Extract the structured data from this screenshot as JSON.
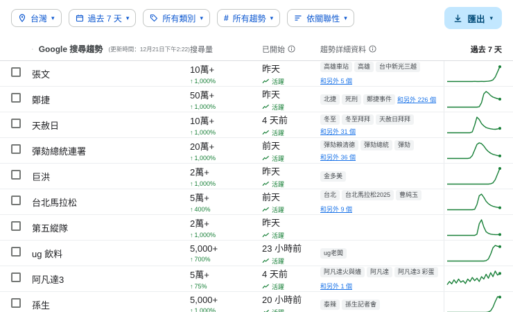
{
  "toolbar": {
    "chips": [
      {
        "icon": "location-pin",
        "label": "台灣"
      },
      {
        "icon": "calendar",
        "label": "過去 7 天"
      },
      {
        "icon": "category-tag",
        "label": "所有類別"
      },
      {
        "icon": "hash",
        "label": "所有趨勢"
      },
      {
        "icon": "sort",
        "label": "依關聯性"
      }
    ],
    "export": {
      "label": "匯出"
    }
  },
  "table": {
    "title": "Google 搜尋趨勢",
    "updated": "(更新時間：12月21日下午2:22)",
    "columns": {
      "volume": "搜尋量",
      "started": "已開始",
      "details": "趨勢詳細資料",
      "past": "過去 7 天"
    },
    "active_label": "活躍",
    "rows": [
      {
        "name": "張文",
        "volume": "10萬+",
        "change": "1,000%",
        "started": "昨天",
        "related": [
          "高雄車站",
          "高雄",
          "台中新光三越"
        ],
        "more": "和另外 5 個",
        "wrap": true,
        "spark": [
          0.02,
          0.02,
          0.02,
          0.02,
          0.02,
          0.02,
          0.02,
          0.02,
          0.02,
          0.02,
          0.02,
          0.02,
          0.03,
          0.02,
          0.02,
          0.03,
          0.02,
          0.03,
          0.04,
          0.06,
          0.12,
          0.3,
          0.62,
          0.95
        ]
      },
      {
        "name": "鄭捷",
        "volume": "50萬+",
        "change": "1,000%",
        "started": "昨天",
        "related": [
          "北捷",
          "死刑",
          "鄭捷事件"
        ],
        "more": "和另外 226 個",
        "wrap": false,
        "spark": [
          0.02,
          0.02,
          0.02,
          0.02,
          0.02,
          0.02,
          0.02,
          0.02,
          0.02,
          0.02,
          0.02,
          0.02,
          0.02,
          0.02,
          0.05,
          0.3,
          0.85,
          1.0,
          0.9,
          0.75,
          0.65,
          0.6,
          0.55,
          0.52
        ]
      },
      {
        "name": "天赦日",
        "volume": "10萬+",
        "change": "1,000%",
        "started": "4 天前",
        "related": [
          "冬至",
          "冬至拜拜",
          "天赦日拜拜"
        ],
        "more": "和另外 31 個",
        "wrap": false,
        "spark": [
          0.02,
          0.02,
          0.02,
          0.02,
          0.02,
          0.02,
          0.02,
          0.02,
          0.02,
          0.02,
          0.02,
          0.08,
          0.5,
          1.0,
          0.85,
          0.6,
          0.45,
          0.35,
          0.3,
          0.27,
          0.25,
          0.24,
          0.26,
          0.3
        ]
      },
      {
        "name": "彈劾總統連署",
        "volume": "20萬+",
        "change": "1,000%",
        "started": "前天",
        "related": [
          "彈劾賴清德",
          "彈劾總統",
          "彈劾"
        ],
        "more": "和另外 36 個",
        "wrap": false,
        "spark": [
          0.02,
          0.02,
          0.02,
          0.02,
          0.02,
          0.02,
          0.02,
          0.02,
          0.02,
          0.02,
          0.05,
          0.2,
          0.55,
          0.9,
          1.0,
          0.95,
          0.8,
          0.6,
          0.45,
          0.35,
          0.28,
          0.24,
          0.2,
          0.18
        ]
      },
      {
        "name": "巨洪",
        "volume": "2萬+",
        "change": "1,000%",
        "started": "昨天",
        "related": [
          "金多美"
        ],
        "more": null,
        "wrap": false,
        "spark": [
          0.02,
          0.02,
          0.02,
          0.02,
          0.02,
          0.02,
          0.02,
          0.02,
          0.02,
          0.02,
          0.02,
          0.02,
          0.02,
          0.02,
          0.02,
          0.02,
          0.02,
          0.02,
          0.02,
          0.04,
          0.1,
          0.3,
          0.65,
          1.0
        ]
      },
      {
        "name": "台北馬拉松",
        "volume": "5萬+",
        "change": "400%",
        "started": "前天",
        "related": [
          "台北",
          "台北馬拉松2025",
          "曹純玉"
        ],
        "more": "和另外 9 個",
        "wrap": true,
        "spark": [
          0.02,
          0.02,
          0.02,
          0.02,
          0.02,
          0.02,
          0.02,
          0.02,
          0.02,
          0.02,
          0.02,
          0.02,
          0.05,
          0.35,
          0.9,
          1.0,
          0.8,
          0.55,
          0.4,
          0.3,
          0.24,
          0.2,
          0.17,
          0.15
        ]
      },
      {
        "name": "第五縱隊",
        "volume": "2萬+",
        "change": "1,000%",
        "started": "昨天",
        "related": [],
        "more": null,
        "wrap": false,
        "spark": [
          0.02,
          0.02,
          0.02,
          0.02,
          0.02,
          0.02,
          0.02,
          0.02,
          0.02,
          0.02,
          0.02,
          0.02,
          0.02,
          0.1,
          0.75,
          1.0,
          0.55,
          0.25,
          0.15,
          0.1,
          0.08,
          0.07,
          0.07,
          0.08
        ]
      },
      {
        "name": "ug 飲料",
        "volume": "5,000+",
        "change": "700%",
        "started": "23 小時前",
        "related": [
          "ug老闆"
        ],
        "more": null,
        "wrap": false,
        "spark": [
          0.02,
          0.02,
          0.02,
          0.02,
          0.02,
          0.02,
          0.02,
          0.02,
          0.02,
          0.02,
          0.02,
          0.02,
          0.02,
          0.02,
          0.02,
          0.02,
          0.02,
          0.05,
          0.15,
          0.45,
          0.85,
          1.0,
          0.95,
          0.92
        ]
      },
      {
        "name": "阿凡達3",
        "volume": "5萬+",
        "change": "75%",
        "started": "4 天前",
        "related": [
          "阿凡達火與燼",
          "阿凡達",
          "阿凡達3 彩蛋"
        ],
        "more": "和另外 1 個",
        "wrap": true,
        "spark": [
          0.15,
          0.35,
          0.2,
          0.45,
          0.25,
          0.5,
          0.3,
          0.4,
          0.22,
          0.5,
          0.35,
          0.6,
          0.4,
          0.55,
          0.35,
          0.65,
          0.5,
          0.8,
          0.55,
          0.9,
          0.65,
          1.0,
          0.75,
          0.85
        ]
      },
      {
        "name": "孫生",
        "volume": "5,000+",
        "change": "1,000%",
        "started": "20 小時前",
        "related": [
          "泰辣",
          "孫生記者會"
        ],
        "more": null,
        "wrap": false,
        "spark": [
          0.02,
          0.02,
          0.02,
          0.02,
          0.02,
          0.02,
          0.02,
          0.02,
          0.02,
          0.02,
          0.02,
          0.02,
          0.02,
          0.02,
          0.02,
          0.02,
          0.02,
          0.02,
          0.05,
          0.12,
          0.35,
          0.7,
          1.0,
          0.98
        ]
      }
    ]
  },
  "colors": {
    "accent_blue": "#0b57d0",
    "link_blue": "#1a73e8",
    "green": "#188038",
    "spark": "#188038",
    "export_bg": "#c2e7ff"
  }
}
